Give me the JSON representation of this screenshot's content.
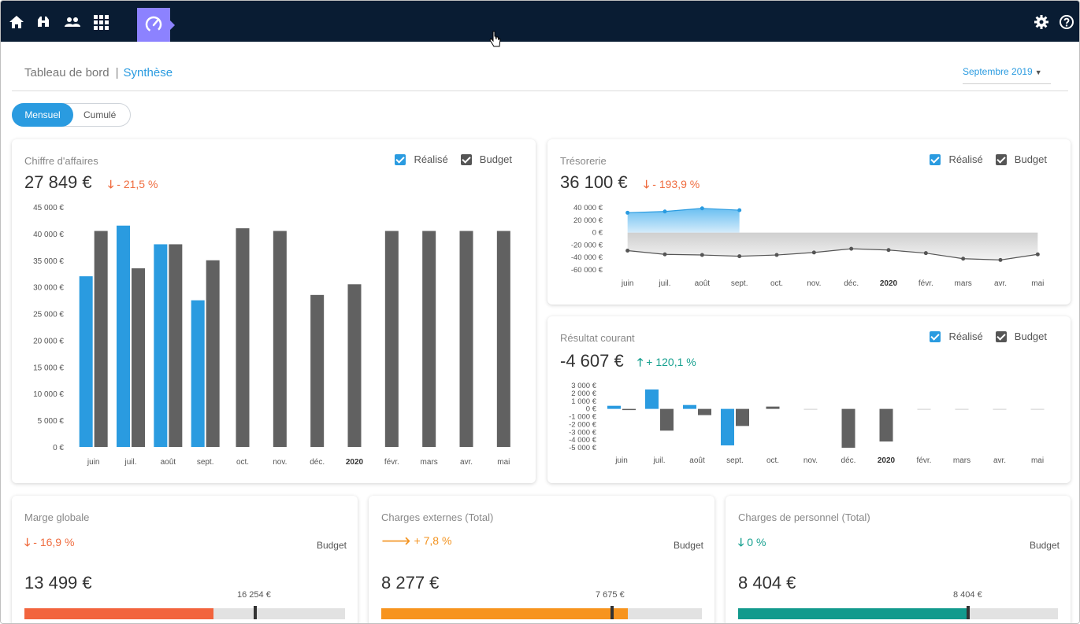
{
  "nav": {
    "icons": [
      "home-icon",
      "binoculars-icon",
      "users-icon",
      "grid-icon",
      "dashboard-gauge-icon",
      "settings-icon",
      "help-icon"
    ]
  },
  "breadcrumb": {
    "root": "Tableau de bord",
    "separator": "|",
    "current": "Synthèse"
  },
  "period": {
    "label": "Septembre 2019"
  },
  "mode": {
    "active": "Mensuel",
    "inactive": "Cumulé"
  },
  "legend": {
    "realise": "Réalisé",
    "budget": "Budget"
  },
  "colors": {
    "realise": "#2a9be0",
    "budget": "#616161",
    "down": "#ef6c3f",
    "up": "#16a08f",
    "orange": "#f39320"
  },
  "ca": {
    "title": "Chiffre d'affaires",
    "value": "27 849 €",
    "delta": "- 21,5 %",
    "chart_data": {
      "type": "bar",
      "categories": [
        "juin",
        "juil.",
        "août",
        "sept.",
        "oct.",
        "nov.",
        "déc.",
        "2020",
        "févr.",
        "mars",
        "avr.",
        "mai"
      ],
      "series": [
        {
          "name": "Réalisé",
          "values": [
            32000,
            41500,
            38000,
            27500,
            null,
            null,
            null,
            null,
            null,
            null,
            null,
            null
          ]
        },
        {
          "name": "Budget",
          "values": [
            40500,
            33500,
            38000,
            35000,
            41000,
            40500,
            28500,
            30500,
            40500,
            40500,
            40500,
            40500
          ]
        }
      ],
      "ylim": [
        0,
        45000
      ],
      "yticks": [
        "0 €",
        "5 000 €",
        "10 000 €",
        "15 000 €",
        "20 000 €",
        "25 000 €",
        "30 000 €",
        "35 000 €",
        "40 000 €",
        "45 000 €"
      ]
    }
  },
  "tresorerie": {
    "title": "Trésorerie",
    "value": "36 100 €",
    "delta": "- 193,9 %",
    "chart_data": {
      "type": "area",
      "categories": [
        "juin",
        "juil.",
        "août",
        "sept.",
        "oct.",
        "nov.",
        "déc.",
        "2020",
        "févr.",
        "mars",
        "avr.",
        "mai"
      ],
      "series": [
        {
          "name": "Réalisé",
          "values": [
            32000,
            34000,
            39000,
            36100,
            null,
            null,
            null,
            null,
            null,
            null,
            null,
            null
          ]
        },
        {
          "name": "Budget",
          "values": [
            -29000,
            -35000,
            -36000,
            -38000,
            -36000,
            -32000,
            -26000,
            -28000,
            -33000,
            -42000,
            -44000,
            -35000
          ]
        }
      ],
      "ylim": [
        -60000,
        40000
      ],
      "yticks": [
        "-60 000 €",
        "-40 000 €",
        "-20 000 €",
        "0 €",
        "20 000 €",
        "40 000 €"
      ]
    }
  },
  "resultat": {
    "title": "Résultat courant",
    "value": "-4 607 €",
    "delta": "+ 120,1 %",
    "chart_data": {
      "type": "bar",
      "categories": [
        "juin",
        "juil.",
        "août",
        "sept.",
        "oct.",
        "nov.",
        "déc.",
        "2020",
        "févr.",
        "mars",
        "avr.",
        "mai"
      ],
      "series": [
        {
          "name": "Réalisé",
          "values": [
            400,
            2500,
            500,
            -4700,
            null,
            null,
            null,
            null,
            null,
            null,
            null,
            null
          ]
        },
        {
          "name": "Budget",
          "values": [
            -100,
            -2800,
            -800,
            -2200,
            300,
            0,
            -5000,
            -4200,
            0,
            0,
            0,
            0
          ]
        }
      ],
      "ylim": [
        -5000,
        3000
      ],
      "yticks": [
        "-5 000 €",
        "-4 000 €",
        "-3 000 €",
        "-2 000 €",
        "-1 000 €",
        "0 €",
        "1 000 €",
        "2 000 €",
        "3 000 €"
      ]
    }
  },
  "kpis": [
    {
      "title": "Marge globale",
      "delta": "- 16,9 %",
      "arrow": "down",
      "budget_label": "Budget",
      "value": "13 499 €",
      "budget_value": "16 254 €",
      "progress": 0.59,
      "budget_mark": 0.715,
      "color": "#f2643d",
      "delta_color": "#ef6c3f"
    },
    {
      "title": "Charges externes (Total)",
      "delta": "+ 7,8 %",
      "arrow": "right",
      "budget_label": "Budget",
      "value": "8 277 €",
      "budget_value": "7 675 €",
      "progress": 0.77,
      "budget_mark": 0.715,
      "color": "#f7941e",
      "delta_color": "#f39320"
    },
    {
      "title": "Charges de personnel (Total)",
      "delta": "0 %",
      "arrow": "down",
      "budget_label": "Budget",
      "value": "8 404 €",
      "budget_value": "8 404 €",
      "progress": 0.715,
      "budget_mark": 0.715,
      "color": "#129a8d",
      "delta_color": "#16a08f"
    }
  ]
}
